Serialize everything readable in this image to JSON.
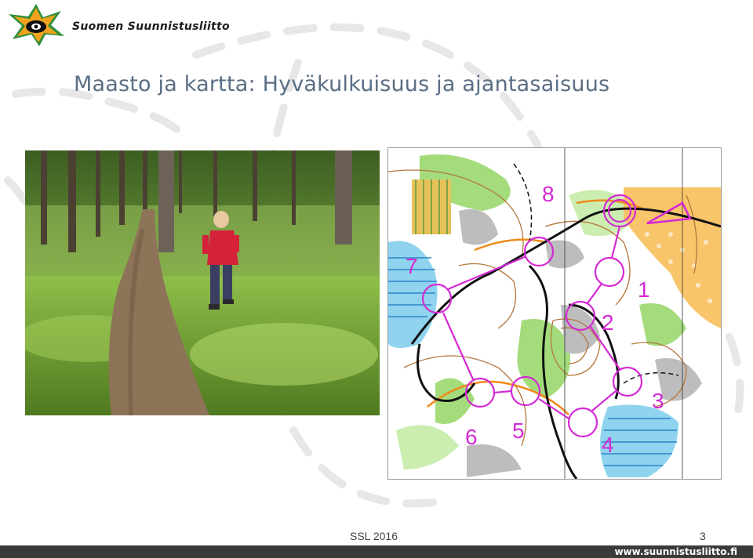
{
  "header": {
    "org_name": "Suomen Suunnistusliitto",
    "logo_icon": "compass-star-logo",
    "title": "Maasto ja kartta: Hyväkulkuisuus ja ajantasaisuus"
  },
  "figures": {
    "photo": "child-running-forest-path-photo",
    "map": "orienteering-map-course"
  },
  "map": {
    "controls": [
      {
        "label": "1"
      },
      {
        "label": "2"
      },
      {
        "label": "3"
      },
      {
        "label": "4"
      },
      {
        "label": "5"
      },
      {
        "label": "6"
      },
      {
        "label": "7"
      },
      {
        "label": "8"
      }
    ]
  },
  "footer": {
    "text": "SSL 2016",
    "page_number": "3",
    "url": "www.suunnistusliitto.fi"
  },
  "colors": {
    "title": "#5a6e84",
    "course_magenta": "#d429d4",
    "footer_bar": "#3a3a3a"
  }
}
